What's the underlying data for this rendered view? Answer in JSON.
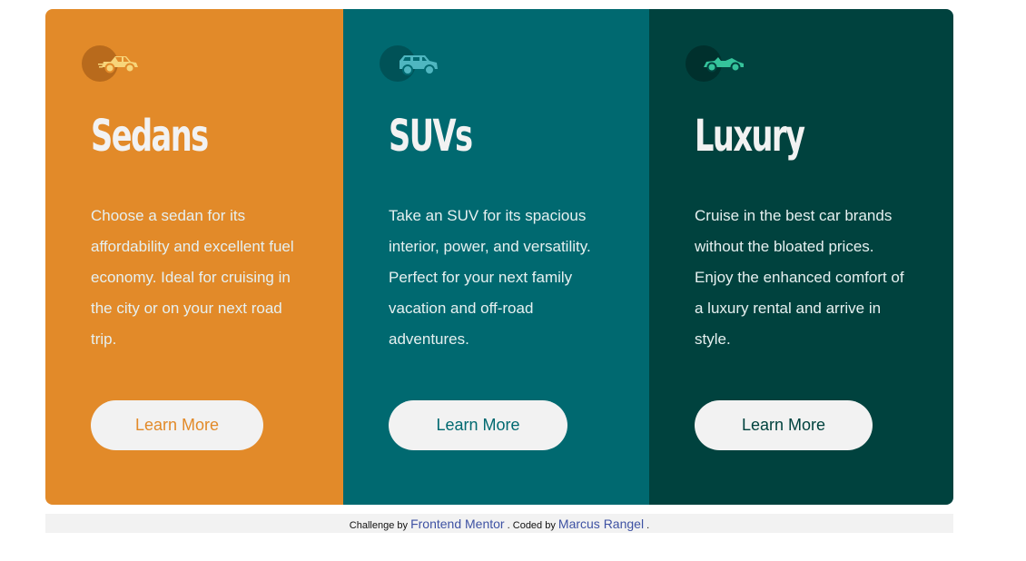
{
  "colors": {
    "sedans": "#e28a29",
    "suvs": "#006970",
    "luxury": "#00423e",
    "button_bg": "#f2f2f2",
    "link": "#3e52a3"
  },
  "cards": [
    {
      "icon": "sedan-car-icon",
      "title": "Sedans",
      "text": "Choose a sedan for its affordability and excellent fuel economy. Ideal for cruising in the city or on your next road trip.",
      "button": "Learn More"
    },
    {
      "icon": "suv-car-icon",
      "title": "SUVs",
      "text": "Take an SUV for its spacious interior, power, and versatility. Perfect for your next family vacation and off-road adventures.",
      "button": "Learn More"
    },
    {
      "icon": "luxury-car-icon",
      "title": "Luxury",
      "text": "Cruise in the best car brands without the bloated prices. Enjoy the enhanced comfort of a luxury rental and arrive in style.",
      "button": "Learn More"
    }
  ],
  "attribution": {
    "prefix": "Challenge by",
    "challenge_link": "Frontend Mentor",
    "middle": ". Coded by",
    "author_link": "Marcus Rangel",
    "suffix": "."
  }
}
